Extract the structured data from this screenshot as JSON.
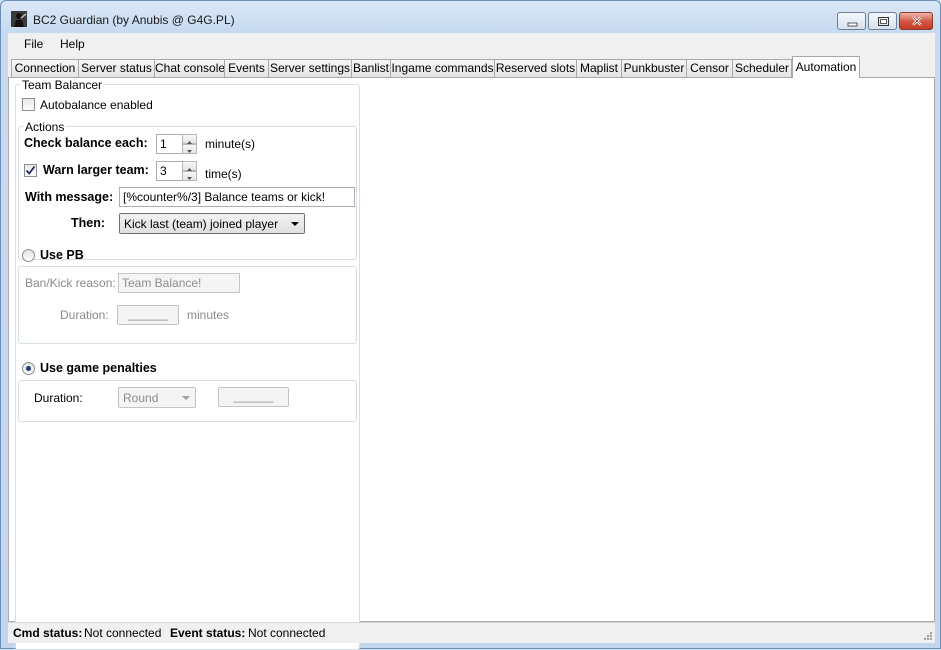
{
  "window": {
    "title": "BC2 Guardian (by Anubis @ G4G.PL)"
  },
  "menu": {
    "file": "File",
    "help": "Help"
  },
  "tabs": [
    {
      "label": "Connection"
    },
    {
      "label": "Server status"
    },
    {
      "label": "Chat console"
    },
    {
      "label": "Events"
    },
    {
      "label": "Server settings"
    },
    {
      "label": "Banlist"
    },
    {
      "label": "Ingame commands"
    },
    {
      "label": "Reserved slots"
    },
    {
      "label": "Maplist"
    },
    {
      "label": "Punkbuster"
    },
    {
      "label": "Censor"
    },
    {
      "label": "Scheduler"
    },
    {
      "label": "Automation",
      "active": true
    }
  ],
  "team_balancer": {
    "legend": "Team Balancer",
    "autobalance_label": "Autobalance enabled",
    "autobalance_checked": false,
    "actions": {
      "legend": "Actions",
      "check_balance_label": "Check balance each:",
      "check_balance_value": "1",
      "check_balance_unit": "minute(s)",
      "warn_label": "Warn larger team:",
      "warn_checked": true,
      "warn_value": "3",
      "warn_unit": "time(s)",
      "message_label": "With message:",
      "message_value": "[%counter%/3] Balance teams or kick!",
      "then_label": "Then:",
      "then_value": "Kick last (team) joined player"
    },
    "use_pb": {
      "label": "Use PB",
      "selected": false,
      "reason_label": "Ban/Kick reason:",
      "reason_value": "Team Balance!",
      "duration_label": "Duration:",
      "duration_button": "______",
      "duration_unit": "minutes"
    },
    "use_game_penalties": {
      "label": "Use game penalties",
      "selected": true,
      "duration_label": "Duration:",
      "duration_value": "Round",
      "duration_button": "______"
    }
  },
  "status": {
    "cmd_label": "Cmd status:",
    "cmd_value": "Not connected",
    "event_label": "Event status:",
    "event_value": "Not connected"
  },
  "icons": {
    "app": "soldier-icon",
    "minimize": "minimize-icon",
    "maximize": "maximize-icon",
    "close": "close-icon",
    "grip": "resize-grip-icon"
  },
  "colors": {
    "titlebar": "#c7daf0",
    "close_button": "#d4533f",
    "client_bg": "#f0f0f0",
    "radio_dot": "#1f3a76"
  }
}
